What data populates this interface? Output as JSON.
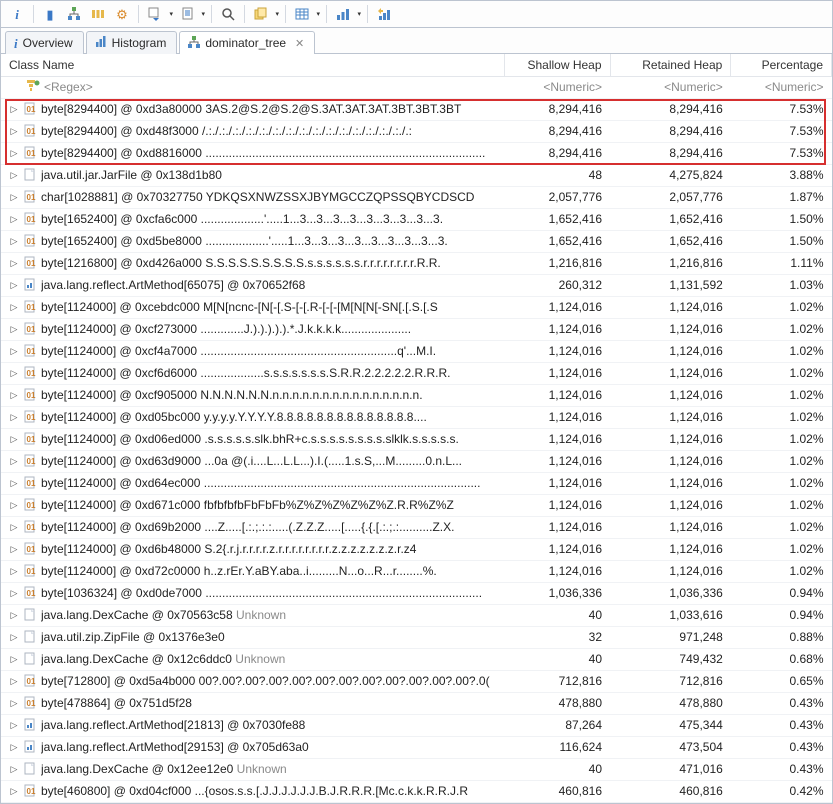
{
  "toolbar": {
    "info": "i",
    "histogram": "▮",
    "tree": "☍",
    "threads": "⚙",
    "run": "▶",
    "report": "📄",
    "search": "🔍",
    "copy": "📋",
    "table": "▦",
    "percent": "%",
    "refresh": "↻"
  },
  "tabs": [
    {
      "icon": "i",
      "label": "Overview"
    },
    {
      "icon": "▮",
      "label": "Histogram"
    },
    {
      "icon": "☍",
      "label": "dominator_tree",
      "active": true
    }
  ],
  "columns": {
    "name": "Class Name",
    "shallow": "Shallow Heap",
    "retained": "Retained Heap",
    "percent": "Percentage"
  },
  "filters": {
    "name": "<Regex>",
    "shallow": "<Numeric>",
    "retained": "<Numeric>",
    "percent": "<Numeric>"
  },
  "rows": [
    {
      "icon": "byteExp",
      "name": "byte[8294400] @ 0xd3a80000  3AS.2@S.2@S.2@S.3AT.3AT.3AT.3BT.3BT.3BT",
      "shallow": "8,294,416",
      "retained": "8,294,416",
      "percent": "7.53%"
    },
    {
      "icon": "byteExp",
      "name": "byte[8294400] @ 0xd48f3000  /.:./.:./.:./.:./.:./.:./.:./.:./.:./.:./.:./.:./.:./.:./.:./.:",
      "shallow": "8,294,416",
      "retained": "8,294,416",
      "percent": "7.53%"
    },
    {
      "icon": "byteExp",
      "name": "byte[8294400] @ 0xd8816000  ....................................................................................",
      "shallow": "8,294,416",
      "retained": "8,294,416",
      "percent": "7.53%"
    },
    {
      "icon": "obj",
      "name": "java.util.jar.JarFile @ 0x138d1b80",
      "shallow": "48",
      "retained": "4,275,824",
      "percent": "3.88%"
    },
    {
      "icon": "byte",
      "name": "char[1028881] @ 0x70327750  YDKQSXNWZSSXJBYMGCCZQPSSQBYCDSCD",
      "shallow": "2,057,776",
      "retained": "2,057,776",
      "percent": "1.87%"
    },
    {
      "icon": "byte",
      "name": "byte[1652400] @ 0xcfa6c000  ...................'.....1...3...3...3...3...3...3...3...3...3.",
      "shallow": "1,652,416",
      "retained": "1,652,416",
      "percent": "1.50%"
    },
    {
      "icon": "byte",
      "name": "byte[1652400] @ 0xd5be8000  ...................'.....1...3...3...3...3...3...3...3...3...3.",
      "shallow": "1,652,416",
      "retained": "1,652,416",
      "percent": "1.50%"
    },
    {
      "icon": "byte",
      "name": "byte[1216800] @ 0xd426a000  S.S.S.S.S.S.S.S.S.s.s.s.s.s.s.r.r.r.r.r.r.r.r.R.R.",
      "shallow": "1,216,816",
      "retained": "1,216,816",
      "percent": "1.11%"
    },
    {
      "icon": "arr",
      "name": "java.lang.reflect.ArtMethod[65075] @ 0x70652f68",
      "shallow": "260,312",
      "retained": "1,131,592",
      "percent": "1.03%"
    },
    {
      "icon": "byte",
      "name": "byte[1124000] @ 0xcebdc000  M[N[ncnc-[N[-[.S-[-[.R-[-[-[M[N[N[-SN[.[.S.[.S",
      "shallow": "1,124,016",
      "retained": "1,124,016",
      "percent": "1.02%"
    },
    {
      "icon": "byte",
      "name": "byte[1124000] @ 0xcf273000  .............J.).).).).).*.J.k.k.k.k.....................",
      "shallow": "1,124,016",
      "retained": "1,124,016",
      "percent": "1.02%"
    },
    {
      "icon": "byte",
      "name": "byte[1124000] @ 0xcf4a7000  ...........................................................q'...M.I.",
      "shallow": "1,124,016",
      "retained": "1,124,016",
      "percent": "1.02%"
    },
    {
      "icon": "byte",
      "name": "byte[1124000] @ 0xcf6d6000  ...................s.s.s.s.s.s.s.S.R.R.2.2.2.2.2.R.R.R.",
      "shallow": "1,124,016",
      "retained": "1,124,016",
      "percent": "1.02%"
    },
    {
      "icon": "byte",
      "name": "byte[1124000] @ 0xcf905000  N.N.N.N.N.N.n.n.n.n.n.n.n.n.n.n.n.n.n.n.n.",
      "shallow": "1,124,016",
      "retained": "1,124,016",
      "percent": "1.02%"
    },
    {
      "icon": "byte",
      "name": "byte[1124000] @ 0xd05bc000  y.y.y.y.Y.Y.Y.Y.8.8.8.8.8.8.8.8.8.8.8.8.8.8....",
      "shallow": "1,124,016",
      "retained": "1,124,016",
      "percent": "1.02%"
    },
    {
      "icon": "byte",
      "name": "byte[1124000] @ 0xd06ed000  .s.s.s.s.s.slk.bhR+c.s.s.s.s.s.s.s.s.slklk.s.s.s.s.s.",
      "shallow": "1,124,016",
      "retained": "1,124,016",
      "percent": "1.02%"
    },
    {
      "icon": "byte",
      "name": "byte[1124000] @ 0xd63d9000  ...0a @(.i....L...L.L...).I.(.....1.s.S,...M.........0.n.L...",
      "shallow": "1,124,016",
      "retained": "1,124,016",
      "percent": "1.02%"
    },
    {
      "icon": "byte",
      "name": "byte[1124000] @ 0xd64ec000  ...................................................................................",
      "shallow": "1,124,016",
      "retained": "1,124,016",
      "percent": "1.02%"
    },
    {
      "icon": "byte",
      "name": "byte[1124000] @ 0xd671c000  fbfbfbfbFbFbFb%Z%Z%Z%Z%Z%Z.R.R%Z%Z",
      "shallow": "1,124,016",
      "retained": "1,124,016",
      "percent": "1.02%"
    },
    {
      "icon": "byte",
      "name": "byte[1124000] @ 0xd69b2000  ....Z.....[.:.;.:.:.....(.Z.Z.Z.....[.....{.{.[.:.;.:..........Z.X.",
      "shallow": "1,124,016",
      "retained": "1,124,016",
      "percent": "1.02%"
    },
    {
      "icon": "byte",
      "name": "byte[1124000] @ 0xd6b48000  S.2{.r.j.r.r.r.r.z.r.r.r.r.r.r.r.r.z.z.z.z.z.z.z.r.z4",
      "shallow": "1,124,016",
      "retained": "1,124,016",
      "percent": "1.02%"
    },
    {
      "icon": "byte",
      "name": "byte[1124000] @ 0xd72c0000  h..z.rEr.Y.aBY.aba..i.........N...o...R...r........%.",
      "shallow": "1,124,016",
      "retained": "1,124,016",
      "percent": "1.02%"
    },
    {
      "icon": "byte",
      "name": "byte[1036324] @ 0xd0de7000  ...................................................................................",
      "shallow": "1,036,336",
      "retained": "1,036,336",
      "percent": "0.94%"
    },
    {
      "icon": "obj",
      "name": "java.lang.DexCache @ 0x70563c58 Unknown",
      "shallow": "40",
      "retained": "1,033,616",
      "percent": "0.94%",
      "unknown": true
    },
    {
      "icon": "obj",
      "name": "java.util.zip.ZipFile @ 0x1376e3e0",
      "shallow": "32",
      "retained": "971,248",
      "percent": "0.88%"
    },
    {
      "icon": "obj",
      "name": "java.lang.DexCache @ 0x12c6ddc0 Unknown",
      "shallow": "40",
      "retained": "749,432",
      "percent": "0.68%",
      "unknown": true
    },
    {
      "icon": "byte",
      "name": "byte[712800] @ 0xd5a4b000  00?.00?.00?.00?.00?.00?.00?.00?.00?.00?.00?.00?.0(",
      "shallow": "712,816",
      "retained": "712,816",
      "percent": "0.65%"
    },
    {
      "icon": "byte",
      "name": "byte[478864] @ 0x751d5f28",
      "shallow": "478,880",
      "retained": "478,880",
      "percent": "0.43%"
    },
    {
      "icon": "arr",
      "name": "java.lang.reflect.ArtMethod[21813] @ 0x7030fe88",
      "shallow": "87,264",
      "retained": "475,344",
      "percent": "0.43%"
    },
    {
      "icon": "arr",
      "name": "java.lang.reflect.ArtMethod[29153] @ 0x705d63a0",
      "shallow": "116,624",
      "retained": "473,504",
      "percent": "0.43%"
    },
    {
      "icon": "obj",
      "name": "java.lang.DexCache @ 0x12ee12e0 Unknown",
      "shallow": "40",
      "retained": "471,016",
      "percent": "0.43%",
      "unknown": true
    },
    {
      "icon": "byte",
      "name": "byte[460800] @ 0xd04cf000  ...{osos.s.s.[.J.J.J.J.J.J.B.J.R.R.R.[Mc.c.k.k.R.R.J.R",
      "shallow": "460,816",
      "retained": "460,816",
      "percent": "0.42%"
    }
  ]
}
